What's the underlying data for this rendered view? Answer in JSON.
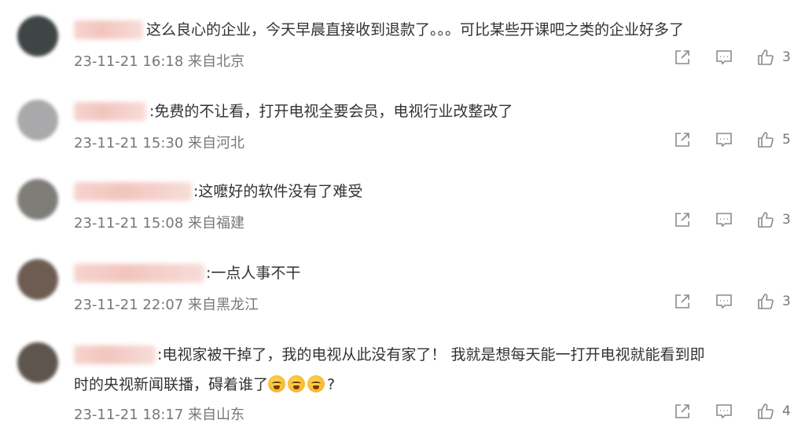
{
  "comments": [
    {
      "text": "这么良心的企业，今天早晨直接收到退款了。。。可比某些开课吧之类的企业好多了",
      "meta": "23-11-21 16:18 来自北京",
      "likes": "3",
      "avatar_color": "#3f4444"
    },
    {
      "text": ":免费的不让看，打开电视全要会员，电视行业改整改了",
      "meta": "23-11-21 15:30 来自河北",
      "likes": "5",
      "avatar_color": "#a9a9ab"
    },
    {
      "text": ":这嚒好的软件没有了难受",
      "meta": "23-11-21 15:08 来自福建",
      "likes": "3",
      "avatar_color": "#7f7d78"
    },
    {
      "text": ":一点人事不干",
      "meta": "23-11-21 22:07 来自黑龙江",
      "likes": "3",
      "avatar_color": "#6e5c52"
    },
    {
      "text_line1": ":电视家被干掉了，我的电视从此没有家了！ 我就是想每天能一打开电视就能看到即",
      "text_line2_prefix": "时的央视新闻联播，碍着谁了",
      "text_line2_suffix": "?",
      "emoji": [
        "crying-emoji",
        "crying-emoji",
        "crying-emoji"
      ],
      "meta": "23-11-21 18:17 来自山东",
      "likes": "4",
      "avatar_color": "#5e564e"
    }
  ],
  "icons": {
    "share": "share-icon",
    "comment": "comment-icon",
    "like": "thumbs-up-icon"
  },
  "colors": {
    "text": "#333333",
    "meta": "#777777",
    "icon": "#8a8a8a"
  }
}
